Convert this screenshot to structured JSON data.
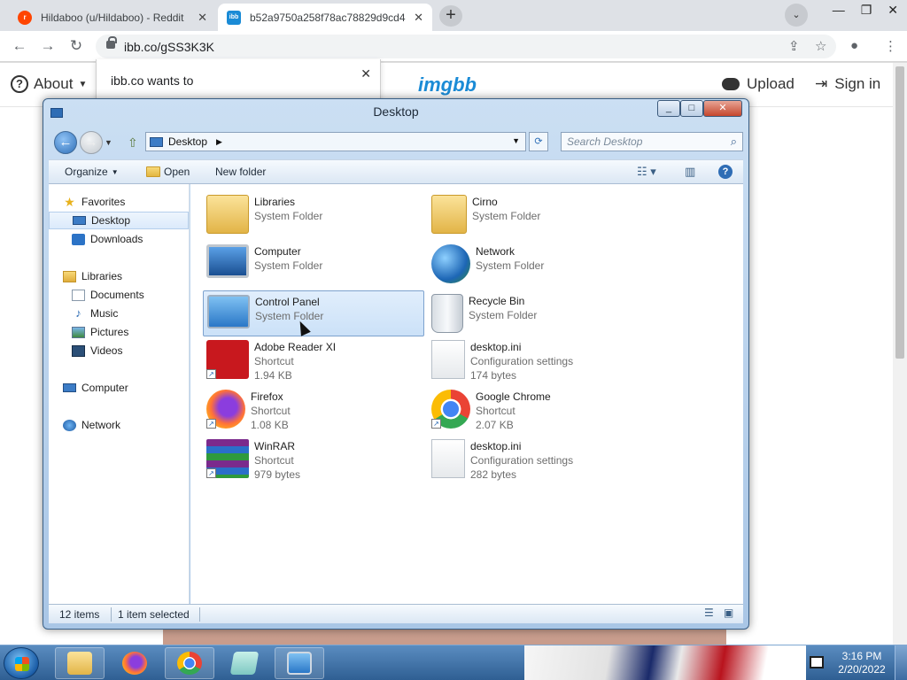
{
  "browser": {
    "tabs": [
      {
        "title": "Hildaboo (u/Hildaboo) - Reddit",
        "favicon": "reddit-icon"
      },
      {
        "title": "b52a9750a258f78ac78829d9cd4",
        "favicon": "ibb-icon",
        "active": true
      }
    ],
    "url": "ibb.co/gSS3K3K",
    "notification": "ibb.co wants to"
  },
  "site": {
    "about_label": "About",
    "logo": "imgbb",
    "upload_label": "Upload",
    "signin_label": "Sign in"
  },
  "explorer": {
    "title": "Desktop",
    "address": "Desktop",
    "search_placeholder": "Search Desktop",
    "commands": {
      "organize": "Organize",
      "open": "Open",
      "new_folder": "New folder"
    },
    "nav": {
      "favorites": "Favorites",
      "desktop": "Desktop",
      "downloads": "Downloads",
      "libraries": "Libraries",
      "documents": "Documents",
      "music": "Music",
      "pictures": "Pictures",
      "videos": "Videos",
      "computer": "Computer",
      "network": "Network"
    },
    "items": [
      {
        "name": "Libraries",
        "type": "System Folder",
        "size": ""
      },
      {
        "name": "Cirno",
        "type": "System Folder",
        "size": ""
      },
      {
        "name": "Computer",
        "type": "System Folder",
        "size": ""
      },
      {
        "name": "Network",
        "type": "System Folder",
        "size": ""
      },
      {
        "name": "Control Panel",
        "type": "System Folder",
        "size": ""
      },
      {
        "name": "Recycle Bin",
        "type": "System Folder",
        "size": ""
      },
      {
        "name": "Adobe Reader XI",
        "type": "Shortcut",
        "size": "1.94 KB"
      },
      {
        "name": "desktop.ini",
        "type": "Configuration settings",
        "size": "174 bytes"
      },
      {
        "name": "Firefox",
        "type": "Shortcut",
        "size": "1.08 KB"
      },
      {
        "name": "Google Chrome",
        "type": "Shortcut",
        "size": "2.07 KB"
      },
      {
        "name": "WinRAR",
        "type": "Shortcut",
        "size": "979 bytes"
      },
      {
        "name": "desktop.ini",
        "type": "Configuration settings",
        "size": "282 bytes"
      }
    ],
    "status": {
      "count": "12 items",
      "selected": "1 item selected"
    }
  },
  "taskbar": {
    "time": "3:16 PM",
    "date": "2/20/2022"
  }
}
